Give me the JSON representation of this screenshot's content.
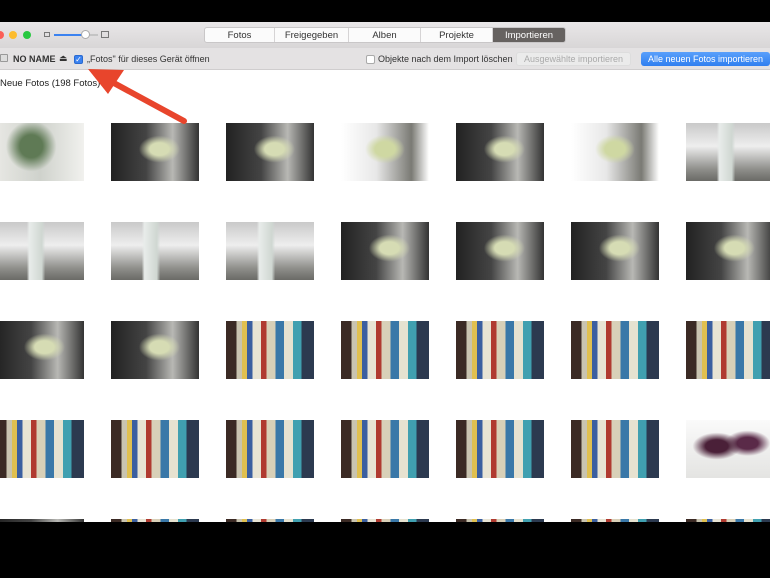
{
  "window": {
    "traffic_lights": [
      "#fc5f57",
      "#fdbc2e",
      "#28c840"
    ]
  },
  "tabs": [
    {
      "label": "Fotos",
      "active": false
    },
    {
      "label": "Freigegeben",
      "active": false
    },
    {
      "label": "Alben",
      "active": false
    },
    {
      "label": "Projekte",
      "active": false
    },
    {
      "label": "Importieren",
      "active": true
    }
  ],
  "slider": {
    "value_percent": 70
  },
  "import_bar": {
    "device_name": "NO NAME",
    "open_photos_label": "„Fotos\" für dieses Gerät öffnen",
    "open_photos_checked": true,
    "delete_after_label": "Objekte nach dem Import löschen",
    "delete_after_checked": false,
    "import_selected_label": "Ausgewählte importieren",
    "import_all_label": "Alle neuen Fotos importieren"
  },
  "content": {
    "section_title": "Neue Fotos (198 Fotos)",
    "thumbnail_rows": [
      [
        "plant",
        "orchid-dark",
        "orchid-dark",
        "orchid-light",
        "orchid-dark",
        "orchid-light",
        "bottle"
      ],
      [
        "bottle",
        "bottle",
        "bottle",
        "orchid-dark",
        "orchid-dark",
        "orchid-dark",
        "orchid-dark"
      ],
      [
        "orchid-dark",
        "orchid-dark",
        "books",
        "books",
        "books",
        "books",
        "books"
      ],
      [
        "books",
        "books",
        "books",
        "books",
        "books",
        "books",
        "orchid-pink"
      ],
      [
        "orchid-dark",
        "books",
        "books",
        "books",
        "books",
        "books",
        "books"
      ]
    ]
  },
  "annotation": {
    "arrow_color": "#e8452c"
  },
  "colors": {
    "accent": "#3b82f0"
  }
}
